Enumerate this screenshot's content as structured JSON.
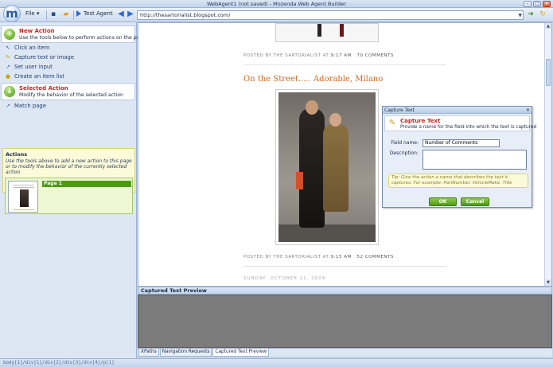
{
  "window": {
    "title": "WebAgent1 (not saved) - Mozenda Web Agent Builder"
  },
  "logo": {
    "letter": "m"
  },
  "toolbar": {
    "file_label": "File",
    "test_agent_label": "Test Agent"
  },
  "address": {
    "url": "http://thesartorialist.blogspot.com/"
  },
  "left_panel": {
    "new_action": {
      "title": "New Action",
      "subtitle": "Use the tools below to perform actions on the page"
    },
    "actions": [
      "Click an item",
      "Capture text or image",
      "Set user input",
      "Create an item list"
    ],
    "selected_action": {
      "title": "Selected Action",
      "subtitle": "Modify the behavior of the selected action"
    },
    "selected_actions": [
      "Match page"
    ],
    "info": {
      "title": "Actions",
      "text": "Use the tools above to add a new action to this page or to modify the behavior of the currently selected action"
    },
    "page_label": "Page 1"
  },
  "blog": {
    "post1_meta": {
      "prefix": "POSTED BY THE SARTORIALIST AT",
      "time": "9:17 AM",
      "comments": "70 COMMENTS"
    },
    "post2_title": "On the Street..... Adorable, Milano",
    "post2_meta": {
      "prefix": "POSTED BY THE SARTORIALIST AT",
      "time": "9:15 AM",
      "comments": "52 COMMENTS"
    },
    "date_header": "SUNDAY, OCTOBER 11, 2009"
  },
  "dialog": {
    "title": "Capture Text",
    "heading": "Capture Text",
    "subheading": "Provide a name for the field into which the text is captured",
    "field_name_label": "Field name:",
    "field_name_value": "Number of Comments",
    "description_label": "Description:",
    "tip": "Tip: Give the action a name that describes the text it captures. For example: PartNumber, VehicleMake, Title",
    "ok_label": "OK",
    "cancel_label": "Cancel"
  },
  "preview": {
    "title": "Captured Text Preview"
  },
  "bottom_tabs": [
    "XPaths",
    "Navigation Requests",
    "Captured Text Preview"
  ],
  "status": {
    "xpath": "body[1]/div[1]/div[2]/div[3]/div[4]/p[1]"
  },
  "colors": {
    "accent_red": "#c8261c",
    "accent_green": "#4e9a16",
    "post_title": "#d2691e"
  }
}
